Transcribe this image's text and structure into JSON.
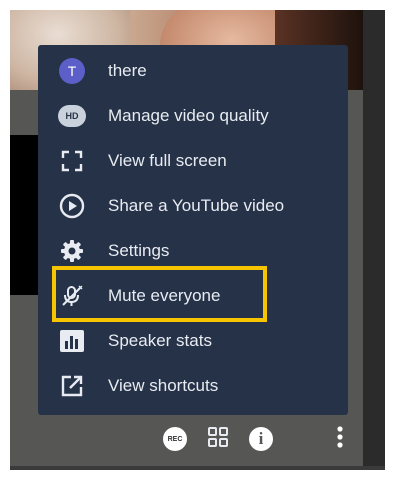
{
  "menu": {
    "items": [
      {
        "label": "there",
        "icon": "avatar",
        "avatar_initial": "T"
      },
      {
        "label": "Manage video quality",
        "icon": "hd-icon",
        "badge_text": "HD"
      },
      {
        "label": "View full screen",
        "icon": "fullscreen-icon"
      },
      {
        "label": "Share a YouTube video",
        "icon": "play-circle-icon"
      },
      {
        "label": "Settings",
        "icon": "gear-icon"
      },
      {
        "label": "Mute everyone",
        "icon": "mute-microphone-icon",
        "highlighted": true
      },
      {
        "label": "Speaker stats",
        "icon": "bar-chart-icon"
      },
      {
        "label": "View shortcuts",
        "icon": "external-link-icon"
      }
    ]
  },
  "toolbar": {
    "record_text": "REC",
    "info_text": "i",
    "icons": [
      "record-icon",
      "tile-view-icon",
      "info-icon",
      "more-options-icon"
    ]
  },
  "colors": {
    "menu_background": "#263247",
    "menu_text": "#e8ecf2",
    "highlight_border": "#f7c400",
    "avatar_background": "#5b5fc7",
    "frame_background": "#565655"
  }
}
